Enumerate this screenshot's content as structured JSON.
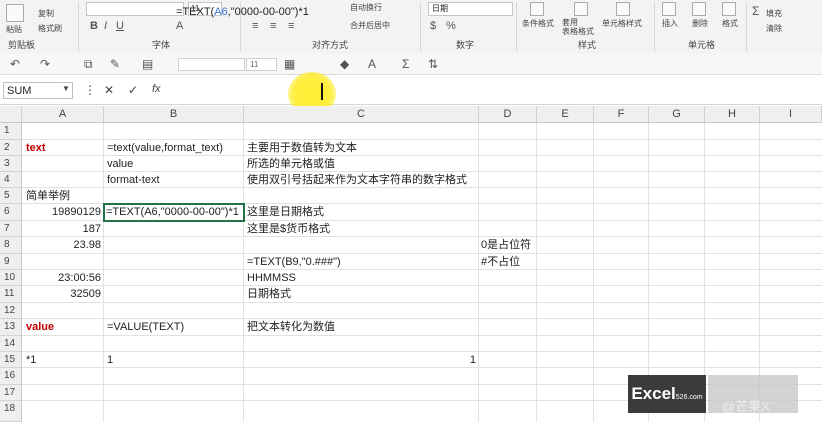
{
  "ribbon": {
    "clipboard": {
      "paste": "粘贴",
      "copy": "复制",
      "format_painter": "格式刷",
      "group": "剪贴板"
    },
    "font": {
      "size": "11",
      "group": "字体"
    },
    "alignment": {
      "wrap": "自动换行",
      "merge": "合并后居中",
      "group": "对齐方式"
    },
    "number": {
      "format": "日期",
      "group": "数字"
    },
    "styles": {
      "conditional": "条件格式",
      "table": "套用\n表格格式",
      "cell_styles": "单元格样式",
      "group": "样式"
    },
    "cells": {
      "insert": "插入",
      "delete": "删除",
      "format": "格式",
      "group": "单元格"
    },
    "editing": {
      "fill": "填充",
      "clear": "清除"
    }
  },
  "qat": {
    "font_size": "11"
  },
  "formula_bar": {
    "name_box": "SUM",
    "fx": "fx",
    "formula_pre": "=TEXT(",
    "formula_ref": "A6",
    "formula_post": ",\"0000-00-00\")*1"
  },
  "columns": [
    "A",
    "B",
    "C",
    "D",
    "E",
    "F",
    "G",
    "H",
    "I"
  ],
  "rows": [
    "1",
    "2",
    "3",
    "4",
    "5",
    "6",
    "7",
    "8",
    "9",
    "10",
    "11",
    "12",
    "13",
    "14",
    "15",
    "16",
    "17",
    "18"
  ],
  "cells": {
    "a2": "text",
    "b2": "=text(value,format_text)",
    "c2": "主要用于数值转为文本",
    "b3": "value",
    "c3": "所选的单元格或值",
    "b4": "format-text",
    "c4": "使用双引号括起来作为文本字符串的数字格式",
    "a5": "简单举例",
    "a6": "19890129",
    "b6": "=TEXT(A6,\"0000-00-00\")*1",
    "c6": "这里是日期格式",
    "a7": "187",
    "c7": "这里是$货币格式",
    "a8": "23.98",
    "d8": "0是占位符",
    "c9": "=TEXT(B9,\"0.###\")",
    "d9": "#不占位",
    "a10": "23:00:56",
    "c10": "HHMMSS",
    "a11": "32509",
    "c11": "日期格式",
    "a13": "value",
    "b13": "=VALUE(TEXT)",
    "c13": "把文本转化为数值",
    "a15": "*1",
    "b15": "1",
    "c15": "1"
  },
  "watermark": {
    "logo": "Excel",
    "site": "526.com",
    "text": "@芒果X"
  },
  "colors": {
    "selection": "#217346",
    "highlight": "#ffee22",
    "label_red": "#c00000"
  }
}
